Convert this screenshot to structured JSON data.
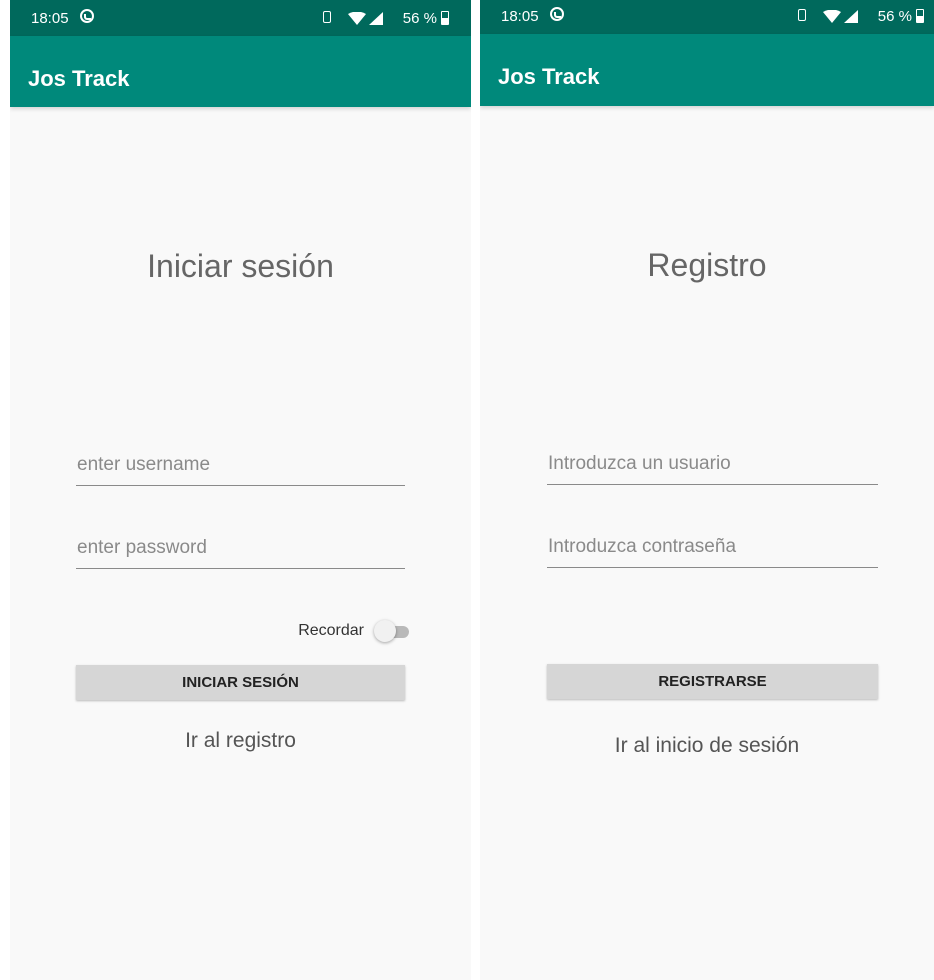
{
  "left_screen": {
    "status": {
      "time": "18:05",
      "battery": "56 %"
    },
    "app_title": "Jos Track",
    "page_title": "Iniciar sesión",
    "username_placeholder": "enter username",
    "password_placeholder": "enter password",
    "remember_label": "Recordar",
    "remember_on": false,
    "submit_label": "INICIAR SESIÓN",
    "link_label": "Ir al registro"
  },
  "right_screen": {
    "status": {
      "time": "18:05",
      "battery": "56 %"
    },
    "app_title": "Jos Track",
    "page_title": "Registro",
    "username_placeholder": "Introduzca un usuario",
    "password_placeholder": "Introduzca contraseña",
    "submit_label": "REGISTRARSE",
    "link_label": "Ir al inicio de sesión"
  },
  "icons": {
    "status": [
      "whatsapp-icon",
      "vibrate-icon",
      "wifi-icon",
      "signal-icon",
      "battery-icon"
    ]
  },
  "colors": {
    "status_bar": "#00695c",
    "app_bar": "#00897b",
    "background": "#f9f9f9",
    "button": "#d6d6d6"
  }
}
